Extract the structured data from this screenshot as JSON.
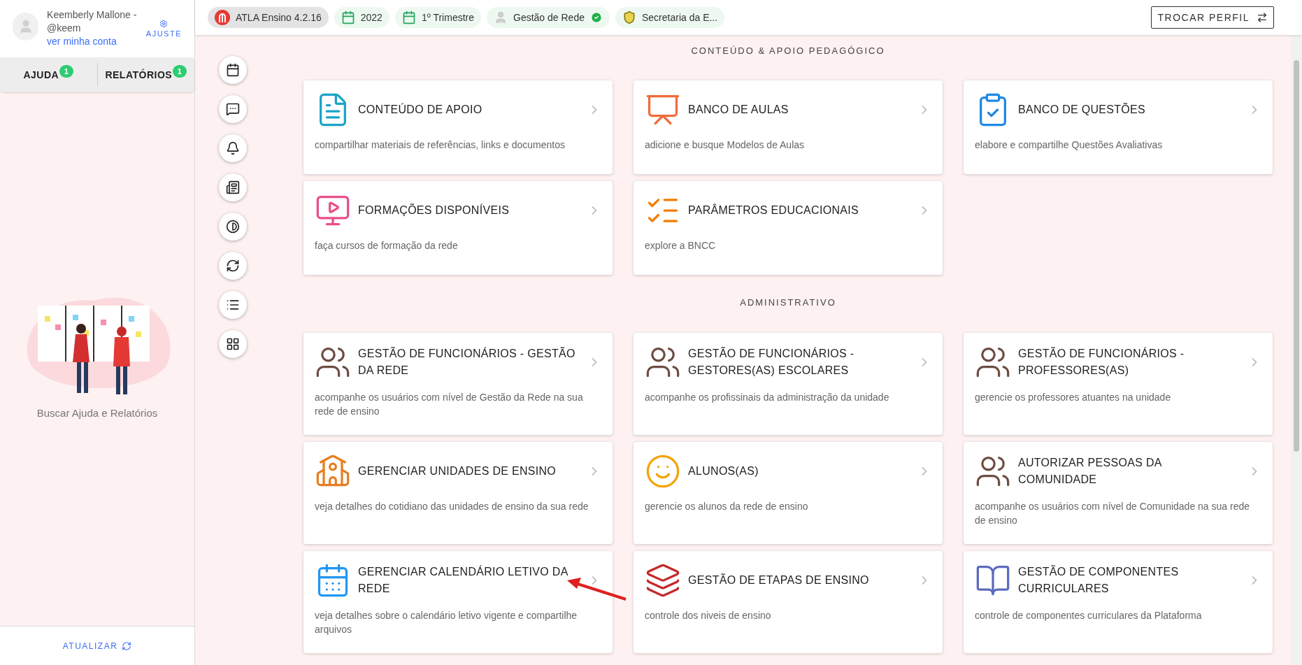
{
  "sidebar": {
    "user": {
      "name": "Keemberly Mallone - @keem",
      "link": "ver minha conta"
    },
    "settings": "AJUSTE",
    "tabs": [
      {
        "label": "AJUDA",
        "badge": "1"
      },
      {
        "label": "RELATÓRIOS",
        "badge": "1"
      }
    ],
    "empty_text": "Buscar Ajuda e Relatórios",
    "refresh": "ATUALIZAR"
  },
  "top_bar": {
    "chips": [
      {
        "kind": "app",
        "label": "ATLA Ensino 4.2.16"
      },
      {
        "kind": "calendar",
        "label": "2022"
      },
      {
        "kind": "calendar",
        "label": "1º Trimestre"
      },
      {
        "kind": "profile",
        "label": "Gestão de Rede",
        "verified": true
      },
      {
        "kind": "crest",
        "label": "Secretaria da E..."
      }
    ],
    "switch_profile": "TROCAR PERFIL"
  },
  "sections": [
    {
      "title": "CONTEÚDO & APOIO PEDAGÓGICO",
      "cards": [
        {
          "title": "CONTEÚDO DE APOIO",
          "description": "compartilhar materiais de referências, links e documentos"
        },
        {
          "title": "BANCO DE AULAS",
          "description": "adicione e busque Modelos de Aulas"
        },
        {
          "title": "BANCO DE QUESTÕES",
          "description": "elabore e compartilhe Questões Avaliativas"
        },
        {
          "title": "FORMAÇÕES DISPONÍVEIS",
          "description": "faça cursos de formação da rede"
        },
        {
          "title": "PARÂMETROS EDUCACIONAIS",
          "description": "explore a BNCC"
        }
      ]
    },
    {
      "title": "ADMINISTRATIVO",
      "cards": [
        {
          "title": "GESTÃO DE FUNCIONÁRIOS - GESTÃO DA REDE",
          "description": "acompanhe os usuários com nível de Gestão da Rede na sua rede de ensino"
        },
        {
          "title": "GESTÃO DE FUNCIONÁRIOS - GESTORES(AS) ESCOLARES",
          "description": "acompanhe os profissinais da administração da unidade"
        },
        {
          "title": "GESTÃO DE FUNCIONÁRIOS - PROFESSORES(AS)",
          "description": "gerencie os professores atuantes na unidade"
        },
        {
          "title": "GERENCIAR UNIDADES DE ENSINO",
          "description": "veja detalhes do cotidiano das unidades de ensino da sua rede"
        },
        {
          "title": "ALUNOS(AS)",
          "description": "gerencie os alunos da rede de ensino"
        },
        {
          "title": "AUTORIZAR PESSOAS DA COMUNIDADE",
          "description": "acompanhe os usuários com nível de Comunidade na sua rede de ensino"
        },
        {
          "title": "GERENCIAR CALENDÁRIO LETIVO DA REDE",
          "description": "veja detalhes sobre o calendário letivo vigente e compartilhe arquivos"
        },
        {
          "title": "GESTÃO DE ETAPAS DE ENSINO",
          "description": "controle dos niveis de ensino"
        },
        {
          "title": "GESTÃO DE COMPONENTES CURRICULARES",
          "description": "controle de componentes curriculares da Plataforma"
        }
      ]
    }
  ]
}
